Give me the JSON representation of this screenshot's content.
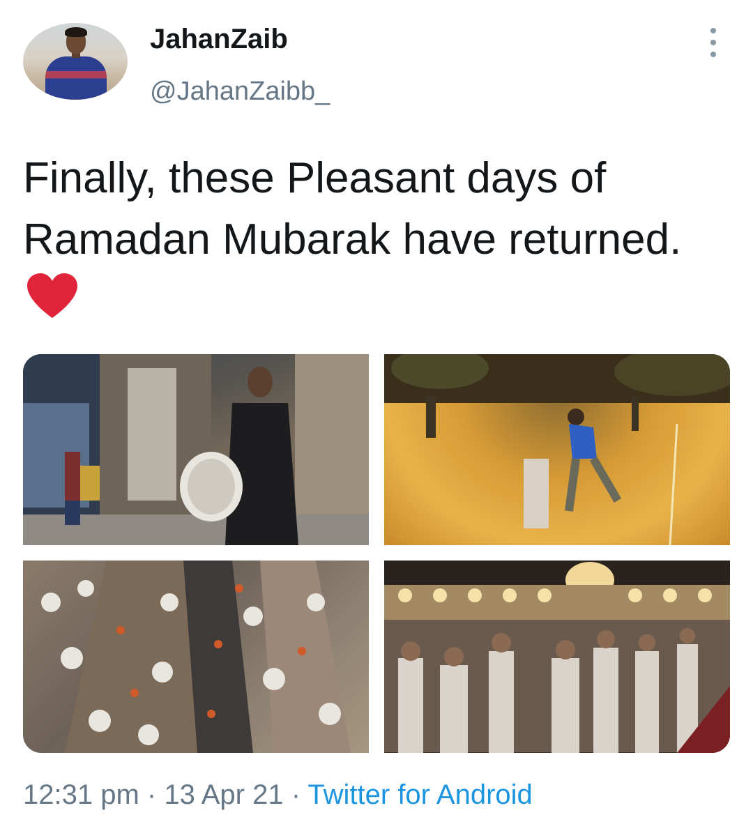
{
  "user": {
    "display_name": "JahanZaib",
    "handle": "@JahanZaibb_"
  },
  "tweet": {
    "text": "Finally, these Pleasant days of Ramadan Mubarak have returned.",
    "emoji": "red-heart"
  },
  "media": [
    {
      "name": "drummer-photo"
    },
    {
      "name": "night-cricket-photo"
    },
    {
      "name": "iftar-gathering-photo"
    },
    {
      "name": "mosque-prayer-photo"
    }
  ],
  "meta": {
    "time": "12:31 pm",
    "sep1": " · ",
    "date": "13 Apr 21",
    "sep2": " · ",
    "source": "Twitter for Android"
  },
  "icons": {
    "more": "more-vertical-icon",
    "heart_color": "#e0243a"
  }
}
